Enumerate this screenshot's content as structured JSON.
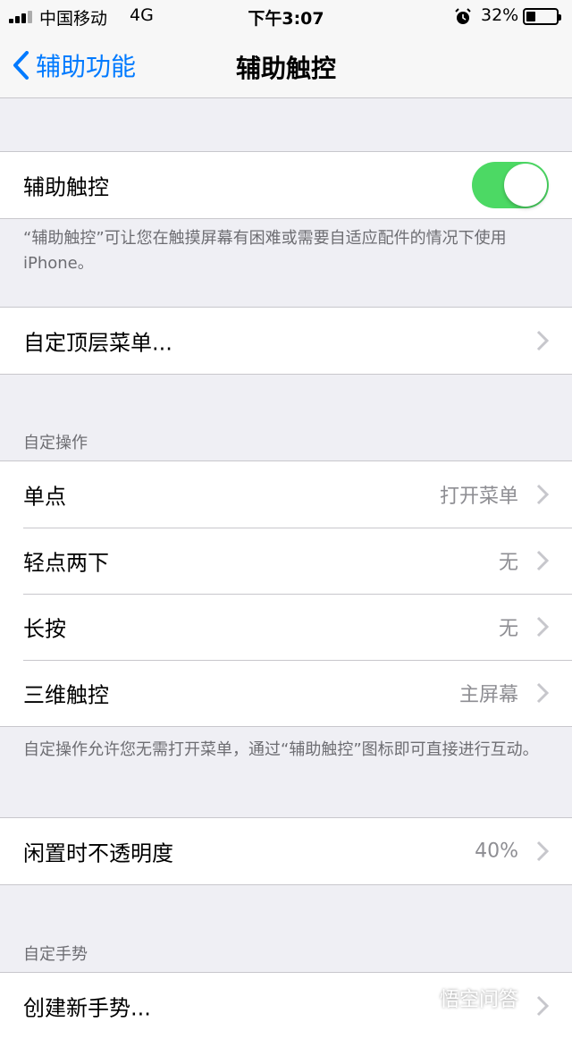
{
  "status_bar": {
    "carrier": "中国移动",
    "network": "4G",
    "time": "下午3:07",
    "battery": "32%",
    "battery_level": 0.32
  },
  "nav": {
    "back_label": "辅助功能",
    "title": "辅助触控"
  },
  "assistive_touch": {
    "label": "辅助触控",
    "enabled": true,
    "footer": "“辅助触控”可让您在触摸屏幕有困难或需要自适应配件的情况下使用 iPhone。"
  },
  "top_menu": {
    "label": "自定顶层菜单..."
  },
  "custom_actions": {
    "header": "自定操作",
    "items": [
      {
        "label": "单点",
        "value": "打开菜单"
      },
      {
        "label": "轻点两下",
        "value": "无"
      },
      {
        "label": "长按",
        "value": "无"
      },
      {
        "label": "三维触控",
        "value": "主屏幕"
      }
    ],
    "footer": "自定操作允许您无需打开菜单，通过“辅助触控”图标即可直接进行互动。"
  },
  "idle_opacity": {
    "label": "闲置时不透明度",
    "value": "40%"
  },
  "custom_gestures": {
    "header": "自定手势",
    "create_label": "创建新手势..."
  },
  "watermark": "悟空问答",
  "colors": {
    "accent": "#007aff",
    "toggle_on": "#4cd964",
    "background": "#efeff4"
  }
}
